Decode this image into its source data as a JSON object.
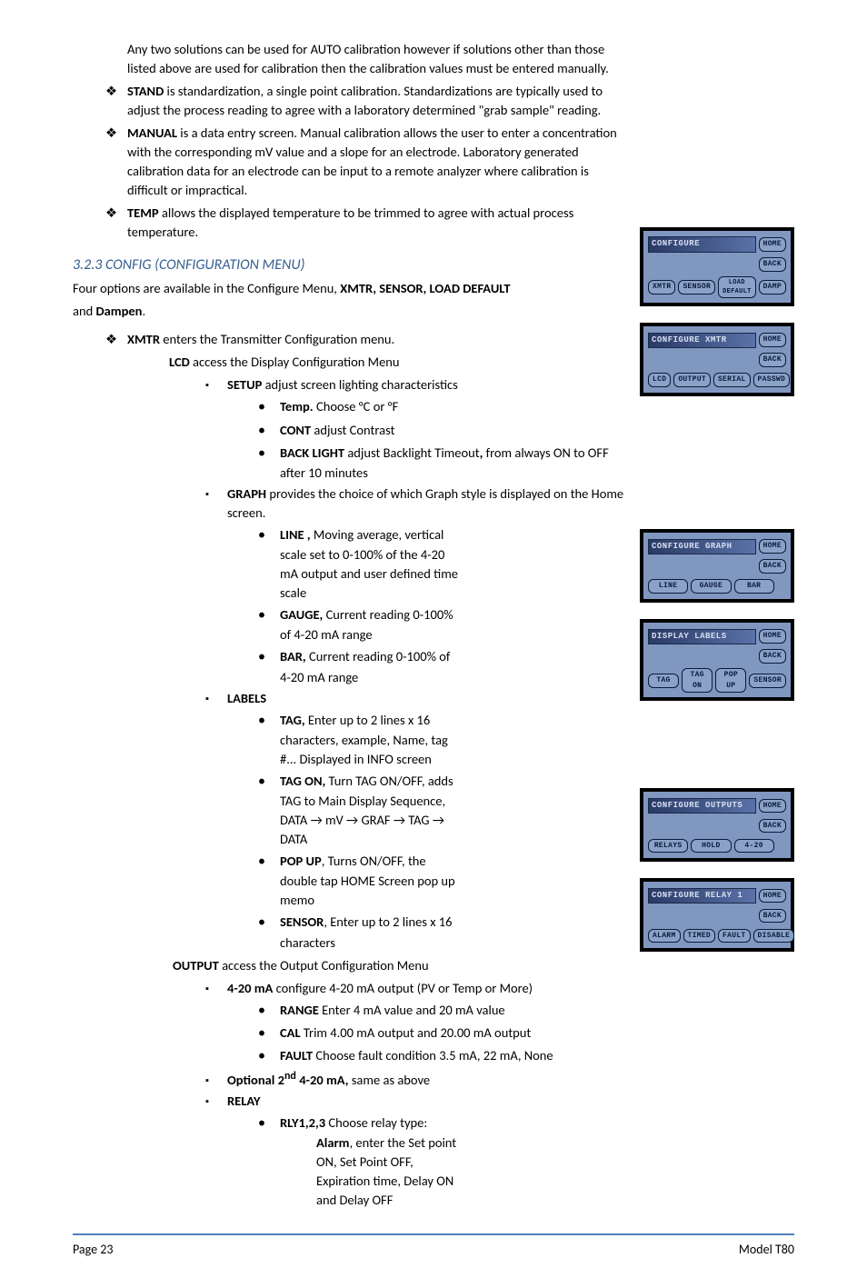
{
  "intro": "Any two solutions can be used for AUTO calibration however if solutions other than those listed above are used for calibration then the calibration values must be entered manually.",
  "bullets1": {
    "stand": {
      "term": "STAND",
      "text": " is standardization, a single point calibration. Standardizations are typically used to adjust the process reading to agree with a laboratory determined \"grab sample\" reading."
    },
    "manual": {
      "term": "MANUAL",
      "text": " is a data entry screen. Manual calibration allows the user to enter a concentration with the corresponding mV value and a slope for an electrode.  Laboratory generated calibration data for an electrode can be input to a remote analyzer where calibration is difficult or impractical."
    },
    "temp": {
      "term": "TEMP",
      "text": " allows the displayed temperature to be trimmed to agree with actual process temperature."
    }
  },
  "h3": "3.2.3 CONFIG (CONFIGURATION MENU)",
  "configIntro1": "Four options are available in the Configure Menu, ",
  "configIntroBold": "XMTR, SENSOR, LOAD DEFAULT",
  "configIntro2": "and ",
  "configIntroBold2": "Dampen",
  "configIntroEnd": ".",
  "xmtr": {
    "term": "XMTR",
    "text": " enters the Transmitter Configuration menu."
  },
  "lcd": {
    "term": "LCD",
    "text": " access  the Display Configuration Menu"
  },
  "setup": {
    "term": "SETUP",
    "text": " adjust screen lighting characteristics"
  },
  "setupItems": {
    "temp": {
      "term": "Temp.",
      "text": " Choose °C or °F"
    },
    "cont": {
      "term": "CONT",
      "text": " adjust Contrast"
    },
    "backlight": {
      "term": "BACK LIGHT",
      "text": " adjust Backlight Timeout",
      "comma": ",",
      "rest": " from always ON to OFF after 10 minutes"
    }
  },
  "graph": {
    "term": "GRAPH",
    "text": " provides the choice of which Graph style is displayed on the Home screen."
  },
  "graphItems": {
    "line": {
      "term": "LINE ,",
      "text": " Moving average, vertical scale set to 0-100% of the 4-20 mA output and user defined time scale"
    },
    "gauge": {
      "term": "GAUGE,",
      "text": " Current reading 0-100% of 4-20 mA range"
    },
    "bar": {
      "term": "BAR,",
      "text": " Current reading 0-100% of 4-20 mA range"
    }
  },
  "labels": {
    "term": "LABELS"
  },
  "labelItems": {
    "tag": {
      "term": "TAG,",
      "text": " Enter up to 2 lines x 16 characters, example, Name, tag #... Displayed in INFO screen"
    },
    "tagon": {
      "term": "TAG ON,",
      "text": " Turn TAG ON/OFF, adds TAG to Main Display Sequence, DATA → mV → GRAF → TAG → DATA"
    },
    "popup": {
      "term": "POP UP",
      "text": ", Turns ON/OFF, the double tap HOME Screen pop up memo"
    },
    "sensor": {
      "term": "SENSOR",
      "text": ", Enter up to 2 lines x 16 characters"
    }
  },
  "output": {
    "term": "OUTPUT",
    "text": " access the Output Configuration Menu"
  },
  "fourtwenty": {
    "term": "4-20 mA",
    "text": " configure 4-20 mA output (PV or Temp or More)"
  },
  "ftItems": {
    "range": {
      "term": "RANGE",
      "text": "  Enter 4 mA value and 20 mA value"
    },
    "cal": {
      "term": "CAL",
      "text": "  Trim 4.00 mA output  and 20.00 mA output"
    },
    "fault": {
      "term": "FAULT",
      "text": " Choose fault condition 3.5 mA, 22 mA, None"
    }
  },
  "optional": {
    "term": "Optional 2",
    "sup": "nd",
    "term2": " 4-20 mA,",
    "text": " same as above"
  },
  "relay": {
    "term": "RELAY"
  },
  "relayItems": {
    "rly": {
      "term": "RLY1,2,3",
      "text": " Choose relay type:"
    },
    "alarm": {
      "term": "Alarm",
      "text": ", enter the Set point ON, Set Point OFF, Expiration time, Delay ON and Delay OFF"
    }
  },
  "footer": {
    "left": "Page 23",
    "right": "Model T80"
  },
  "screens": {
    "s1": {
      "title": "CONFIGURE",
      "home": "HOME",
      "back": "BACK",
      "b1": "XMTR",
      "b2": "SENSOR",
      "b3": "LOAD DEFAULT",
      "b4": "DAMP"
    },
    "s2": {
      "title": "CONFIGURE XMTR",
      "home": "HOME",
      "back": "BACK",
      "b1": "LCD",
      "b2": "OUTPUT",
      "b3": "SERIAL",
      "b4": "PASSWD"
    },
    "s3": {
      "title": "CONFIGURE GRAPH",
      "home": "HOME",
      "back": "BACK",
      "b1": "LINE",
      "b2": "GAUGE",
      "b3": "BAR"
    },
    "s4": {
      "title": "DISPLAY LABELS",
      "home": "HOME",
      "back": "BACK",
      "b1": "TAG",
      "b2": "TAG ON",
      "b3": "POP UP",
      "b4": "SENSOR"
    },
    "s5": {
      "title": "CONFIGURE OUTPUTS",
      "home": "HOME",
      "back": "BACK",
      "b1": "RELAYS",
      "b2": "HOLD",
      "b3": "4-20"
    },
    "s6": {
      "title": "CONFIGURE RELAY 1",
      "home": "HOME",
      "back": "BACK",
      "b1": "ALARM",
      "b2": "TIMED",
      "b3": "FAULT",
      "b4": "DISABLE"
    }
  }
}
